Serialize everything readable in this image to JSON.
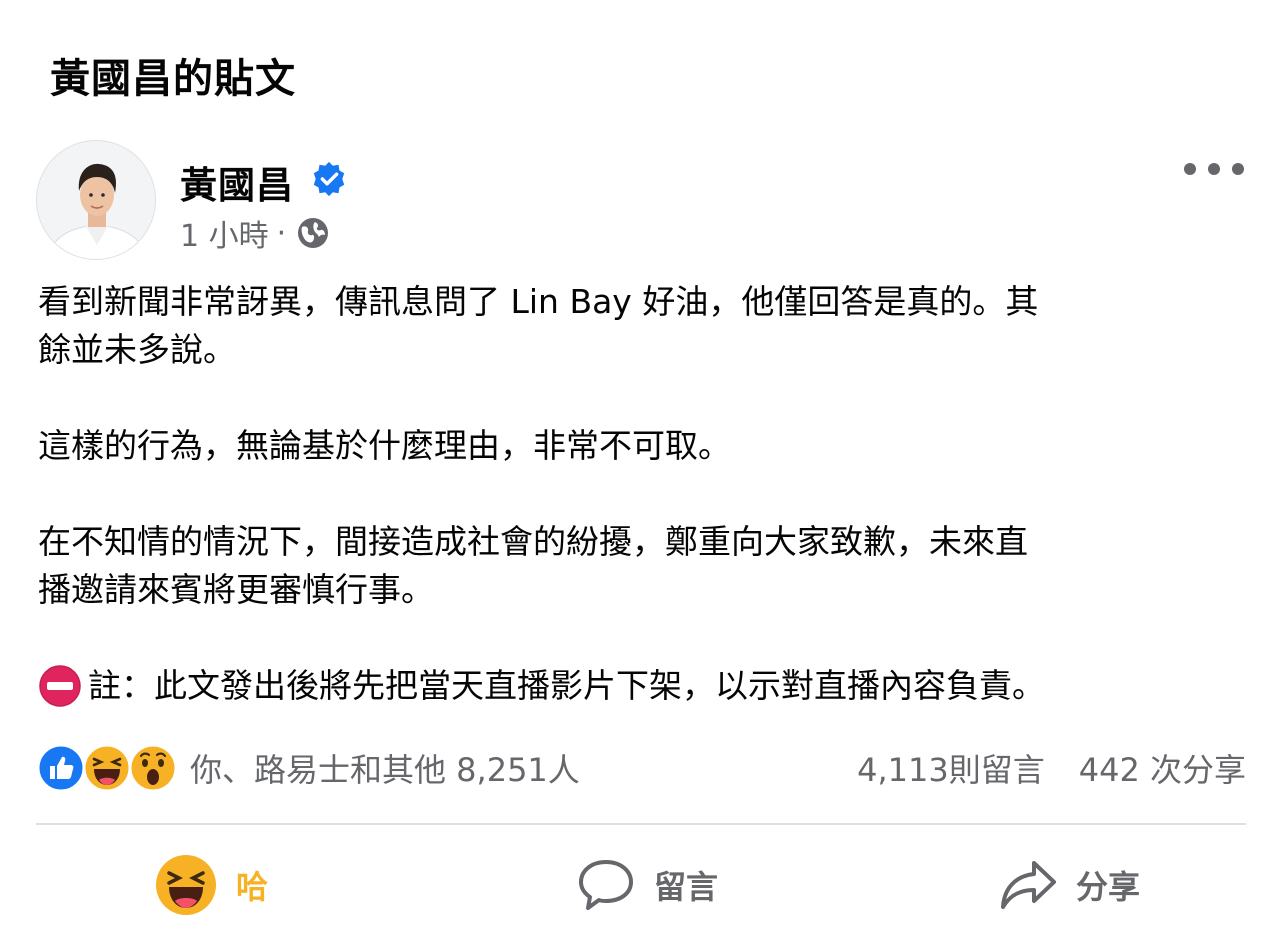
{
  "page": {
    "title": "黃國昌的貼文"
  },
  "post": {
    "author": "黃國昌",
    "verified": true,
    "time": "1 小時",
    "separator": "·",
    "audience_icon": "globe-icon",
    "paragraphs": [
      "看到新聞非常訝異，傳訊息問了 Lin Bay 好油，他僅回答是真的。其\n餘並未多說。",
      "這樣的行為，無論基於什麼理由，非常不可取。",
      "在不知情的情況下，間接造成社會的紛擾，鄭重向大家致歉，未來直\n播邀請來賓將更審慎行事。"
    ],
    "note": "註：此文發出後將先把當天直播影片下架，以示對直播內容負責。",
    "note_icon": "no-entry-icon"
  },
  "reactions": {
    "icons": [
      "like-icon",
      "haha-icon",
      "wow-icon"
    ],
    "summary": "你、路易士和其他 8,251人",
    "comments": "4,113則留言",
    "shares": "442 次分享"
  },
  "actions": {
    "reaction_label": "哈",
    "comment_label": "留言",
    "share_label": "分享"
  },
  "colors": {
    "verified_blue": "#1877f2",
    "haha_yellow": "#f7b125",
    "secondary_text": "#65676b",
    "no_entry_red": "#e0245e"
  }
}
